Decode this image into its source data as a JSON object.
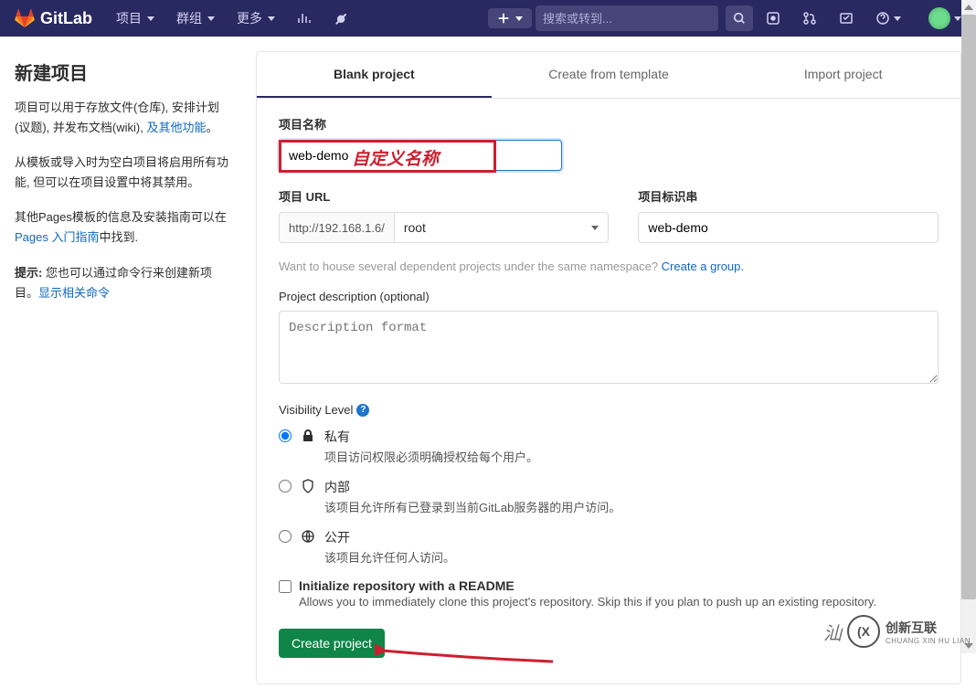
{
  "topbar": {
    "brand": "GitLab",
    "nav": {
      "projects": "项目",
      "groups": "群组",
      "more": "更多"
    },
    "search_placeholder": "搜索或转到...",
    "plus_label": "+"
  },
  "sidebar": {
    "title": "新建项目",
    "para1_before": "项目可以用于存放文件(仓库), 安排计划(议题), 并发布文档(wiki), ",
    "para1_link": "及其他功能",
    "para1_after": "。",
    "para2": "从模板或导入时为空白项目将启用所有功能, 但可以在项目设置中将其禁用。",
    "para3_before": "其他Pages模板的信息及安装指南可以在",
    "para3_link": "Pages 入门指南",
    "para3_after": "中找到.",
    "tip_label": "提示:",
    "tip_text": " 您也可以通过命令行来创建新项目。",
    "tip_link": "显示相关命令"
  },
  "tabs": {
    "blank": "Blank project",
    "template": "Create from template",
    "import": "Import project"
  },
  "form": {
    "name_label": "项目名称",
    "name_value": "web-demo",
    "name_annotation": "自定义名称",
    "url_label": "项目 URL",
    "url_prefix": "http://192.168.1.6/",
    "url_namespace": "root",
    "slug_label": "项目标识串",
    "slug_value": "web-demo",
    "namespace_hint_before": "Want to house several dependent projects under the same namespace? ",
    "namespace_hint_link": "Create a group.",
    "desc_label": "Project description (optional)",
    "desc_placeholder": "Description format",
    "vis_label": "Visibility Level",
    "vis_private_title": "私有",
    "vis_private_desc": "项目访问权限必须明确授权给每个用户。",
    "vis_internal_title": "内部",
    "vis_internal_desc": "该项目允许所有已登录到当前GitLab服务器的用户访问。",
    "vis_public_title": "公开",
    "vis_public_desc": "该项目允许任何人访问。",
    "readme_label": "Initialize repository with a README",
    "readme_desc": "Allows you to immediately clone this project's repository. Skip this if you plan to push up an existing repository.",
    "create_btn": "Create project"
  },
  "watermark": {
    "text": "创新互联",
    "sub": "CHUANG XIN HU LIAN",
    "logo": "(X"
  }
}
